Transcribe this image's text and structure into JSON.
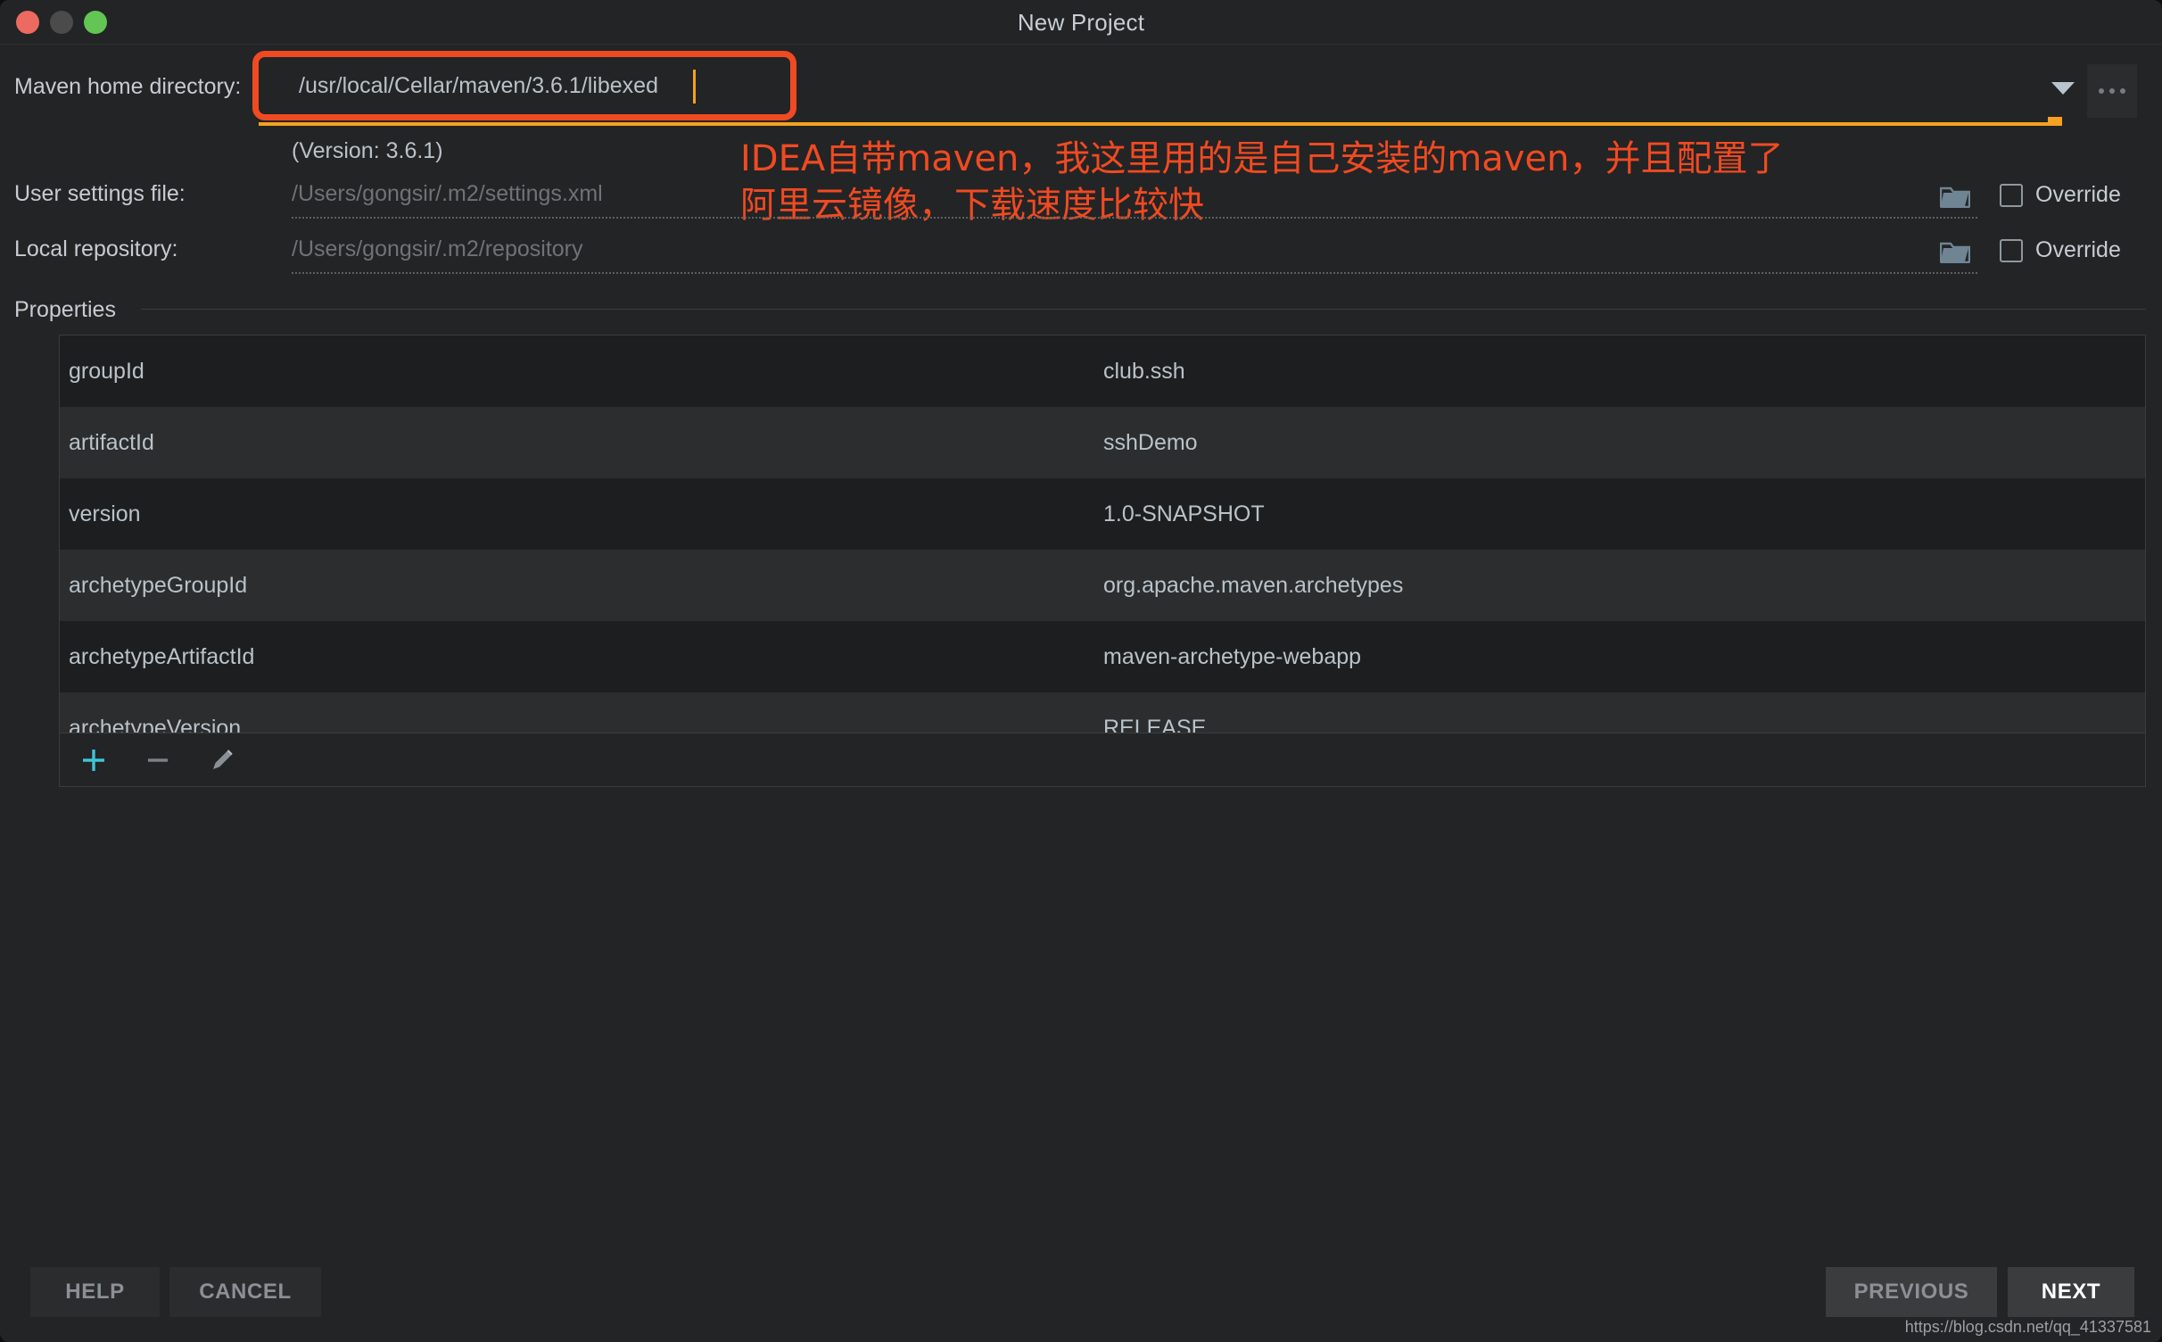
{
  "window": {
    "title": "New Project",
    "traffic_lights": [
      "close-red",
      "minimize-gray",
      "maximize-green"
    ]
  },
  "form": {
    "maven_home": {
      "label": "Maven home directory:",
      "value": "/usr/local/Cellar/maven/3.6.1/libexed",
      "version_note": "(Version: 3.6.1)",
      "dropdown_icon": "chevron-down-icon",
      "browse_icon": "ellipsis-icon"
    },
    "user_settings": {
      "label": "User settings file:",
      "placeholder": "/Users/gongsir/.m2/settings.xml",
      "override_label": "Override",
      "override_checked": false,
      "folder_icon": "folder-icon"
    },
    "local_repository": {
      "label": "Local repository:",
      "placeholder": "/Users/gongsir/.m2/repository",
      "override_label": "Override",
      "override_checked": false,
      "folder_icon": "folder-icon"
    }
  },
  "annotation": {
    "text": "IDEA自带maven，我这里用的是自己安装的maven，并且配置了\n阿里云镜像，下载速度比较快",
    "color": "#f04a22",
    "highlight_box_color": "#f04a22",
    "underline_color": "#f4a220"
  },
  "properties": {
    "section_label": "Properties",
    "rows": [
      {
        "key": "groupId",
        "value": "club.ssh"
      },
      {
        "key": "artifactId",
        "value": "sshDemo"
      },
      {
        "key": "version",
        "value": "1.0-SNAPSHOT"
      },
      {
        "key": "archetypeGroupId",
        "value": "org.apache.maven.archetypes"
      },
      {
        "key": "archetypeArtifactId",
        "value": "maven-archetype-webapp"
      },
      {
        "key": "archetypeVersion",
        "value": "RELEASE"
      }
    ],
    "toolbar": [
      {
        "icon": "plus-icon",
        "color": "#3fc3d6"
      },
      {
        "icon": "minus-icon",
        "color": "#7b8085"
      },
      {
        "icon": "pencil-icon",
        "color": "#8b9096"
      }
    ]
  },
  "footer": {
    "help_label": "HELP",
    "cancel_label": "CANCEL",
    "previous_label": "PREVIOUS",
    "next_label": "NEXT",
    "watermark": "https://blog.csdn.net/qq_41337581"
  }
}
